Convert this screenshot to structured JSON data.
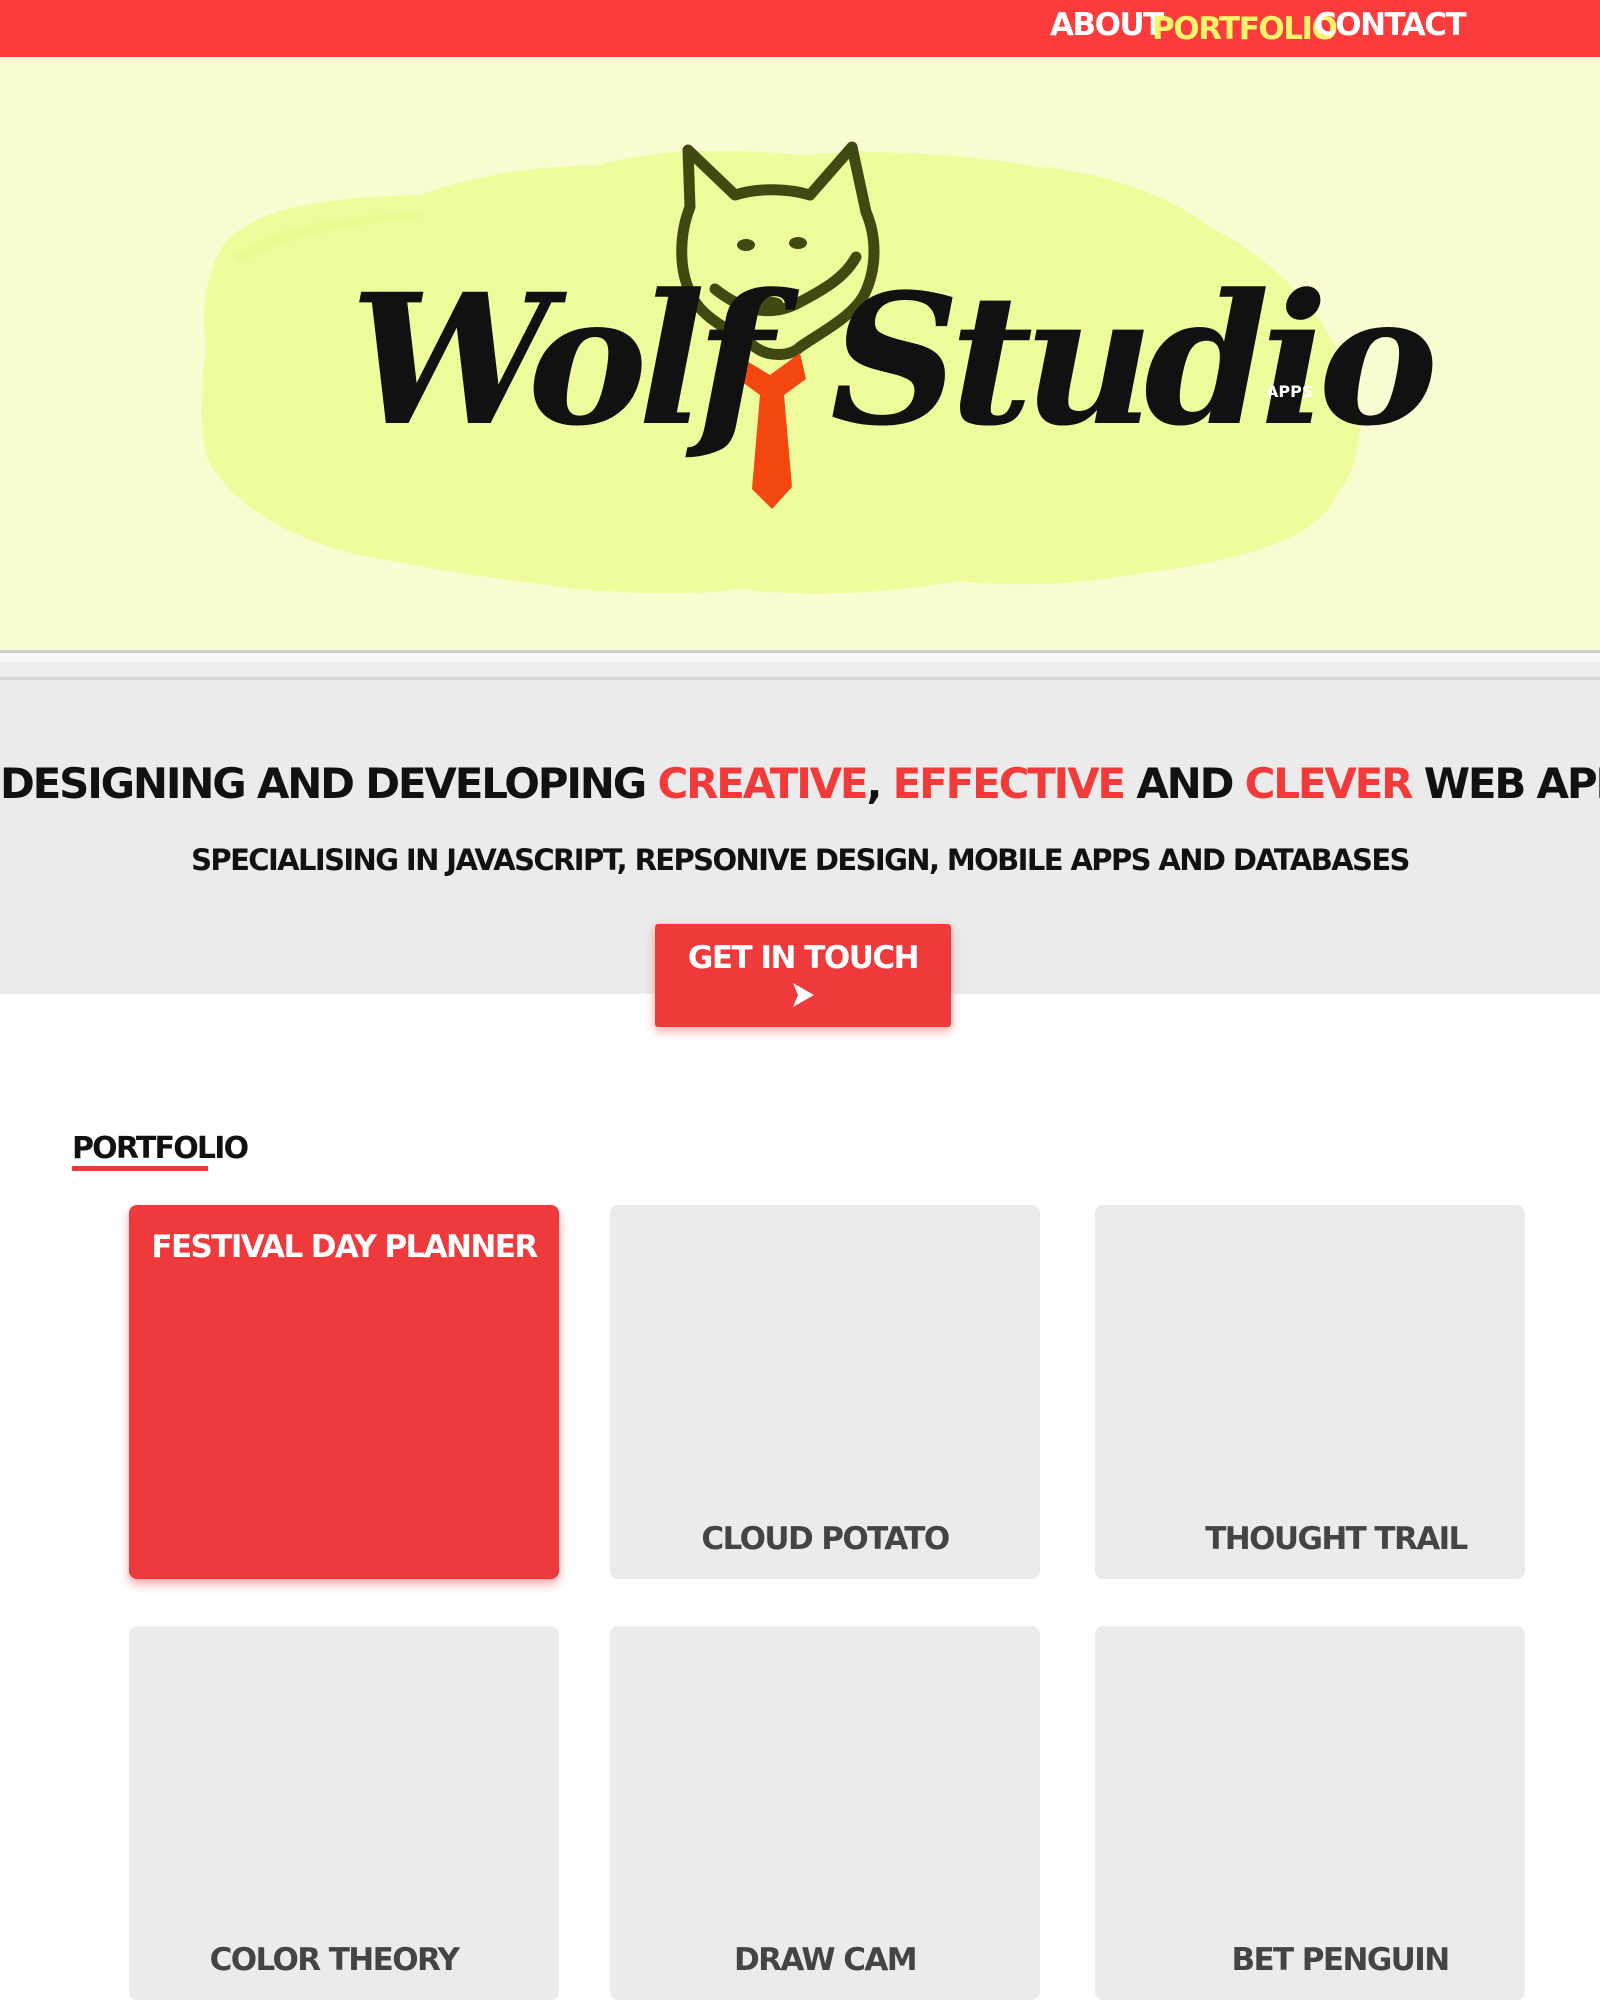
{
  "nav": {
    "items": [
      {
        "label": "ABOUT"
      },
      {
        "label": "PORTFOLIO",
        "active": true
      },
      {
        "label": "CONTACT"
      }
    ]
  },
  "hero": {
    "logo_word_left": "Wolf",
    "logo_word_right": "Studio",
    "logo_badge": "APPS"
  },
  "tagline": {
    "parts": [
      "DESIGNING AND DEVELOPING ",
      "CREATIVE",
      ", ",
      "EFFECTIVE",
      " AND ",
      "CLEVER",
      " WEB APPS."
    ],
    "sub": "SPECIALISING IN JAVASCRIPT, REPSONIVE DESIGN, MOBILE APPS AND DATABASES"
  },
  "cta": {
    "label": "GET IN TOUCH"
  },
  "portfolio": {
    "title": "PORTFOLIO",
    "projects": [
      {
        "title": "FESTIVAL DAY PLANNER"
      },
      {
        "title": "CLOUD POTATO"
      },
      {
        "title": "THOUGHT TRAIL"
      },
      {
        "title": "COLOR THEORY"
      },
      {
        "title": "DRAW CAM"
      },
      {
        "title": "BET PENGUIN"
      }
    ]
  },
  "colors": {
    "nav_bg": "#fb3b3c",
    "nav_active": "#fbf46b",
    "accent": "#ef3a3c",
    "hero_bg": "#f8fcd0",
    "hero_blob": "#eefc9c",
    "tie": "#f44710",
    "band_bg": "#ebebeb"
  }
}
